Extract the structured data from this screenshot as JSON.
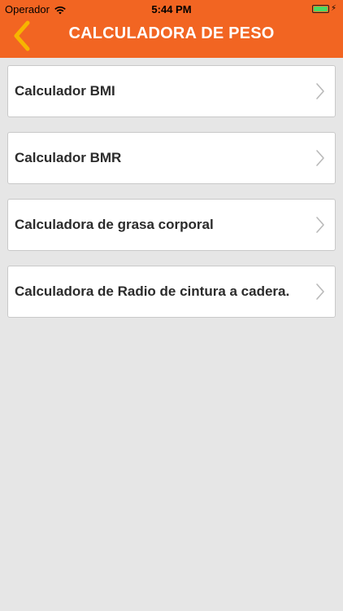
{
  "status_bar": {
    "carrier": "Operador",
    "time": "5:44 PM"
  },
  "navbar": {
    "title": "CALCULADORA DE PESO",
    "back_icon": "chevron-left-icon"
  },
  "menu": {
    "items": [
      {
        "label": "Calculador BMI"
      },
      {
        "label": "Calculador BMR"
      },
      {
        "label": "Calculadora de grasa corporal"
      },
      {
        "label": "Calculadora de Radio de cintura a cadera."
      }
    ]
  },
  "colors": {
    "accent": "#f26522",
    "back_arrow": "#f7b500",
    "background": "#e6e6e6",
    "battery": "#4cd964"
  }
}
